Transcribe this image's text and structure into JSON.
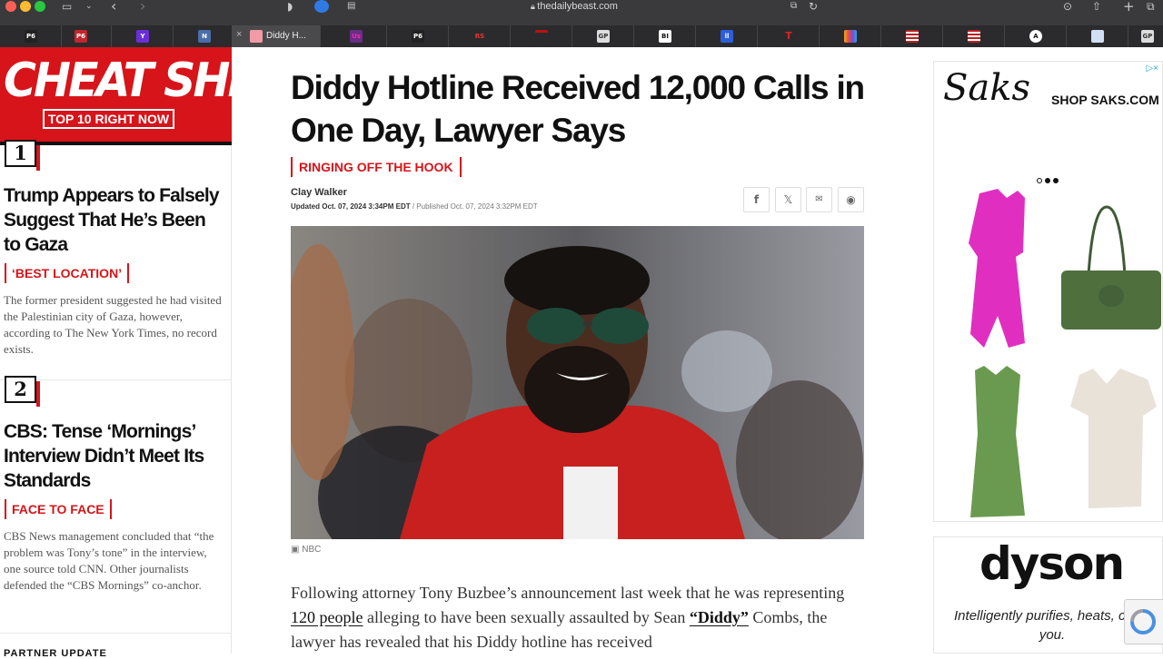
{
  "browser": {
    "url": "thedailybeast.com",
    "active_tab_label": "Diddy H...",
    "tab_favicons": [
      "Page Six",
      "Page Six",
      "Yahoo",
      "News",
      "Diddy",
      "US",
      "Page Six",
      "RS",
      "News",
      "GP",
      "BI",
      "Paramount",
      "T",
      "NBC",
      "US flag",
      "US flag",
      "A",
      "News",
      "GP"
    ]
  },
  "cheat_sheet": {
    "title": "CHEAT SHEET",
    "subtitle": "TOP 10 RIGHT NOW",
    "items": [
      {
        "number": "1",
        "headline": "Trump Appears to Falsely Suggest That He’s Been to Gaza",
        "tag": "‘BEST LOCATION’",
        "summary": "The former president suggested he had visited the Palestinian city of Gaza, however, according to The New York Times, no record exists."
      },
      {
        "number": "2",
        "headline": "CBS: Tense ‘Mornings’ Interview Didn’t Meet Its Standards",
        "tag": "FACE TO FACE",
        "summary": "CBS News management concluded that “the problem was Tony’s tone” in the interview, one source told CNN. Other journalists defended the “CBS Mornings” co-anchor."
      }
    ],
    "partner_label": "PARTNER UPDATE"
  },
  "article": {
    "title": "Diddy Hotline Received 12,000 Calls in One Day, Lawyer Says",
    "kicker": "RINGING OFF THE HOOK",
    "author": "Clay Walker",
    "updated": "Updated Oct. 07, 2024 3:34PM EDT",
    "published": " / Published Oct. 07, 2024 3:32PM EDT",
    "photo_credit": "NBC",
    "body": {
      "p1_a": "Following attorney Tony Buzbee’s announcement last week that he was representing ",
      "p1_link1": "120 people",
      "p1_b": " alleging to have been sexually assaulted by Sean ",
      "p1_link2": "“Diddy”",
      "p1_c": " Combs, the lawyer has revealed that his Diddy hotline has received"
    },
    "share_icons": [
      "facebook-icon",
      "x-icon",
      "email-icon",
      "reddit-icon"
    ]
  },
  "ads": {
    "saks": {
      "logo": "Saks",
      "cta": "SHOP SAKS.COM ›"
    },
    "dyson": {
      "logo": "dyson",
      "tagline": "Intelligently purifies, heats, cools you."
    }
  }
}
